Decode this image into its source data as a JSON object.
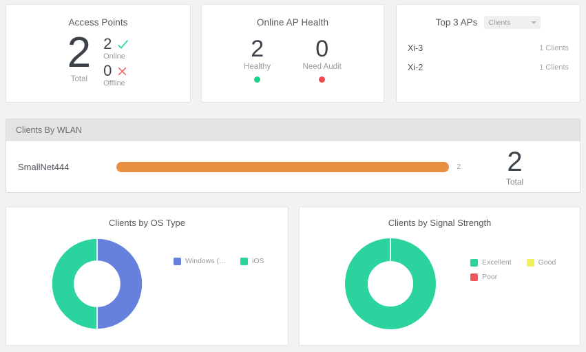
{
  "access_points": {
    "title": "Access Points",
    "total_value": "2",
    "total_label": "Total",
    "online_value": "2",
    "online_label": "Online",
    "online_icon": "check-icon",
    "online_color": "#2ed3a3",
    "offline_value": "0",
    "offline_label": "Offline",
    "offline_icon": "cross-icon",
    "offline_color": "#ef5b5b"
  },
  "ap_health": {
    "title": "Online AP Health",
    "items": [
      {
        "value": "2",
        "label": "Healthy",
        "dot_color": "#1fd18f"
      },
      {
        "value": "0",
        "label": "Need Audit",
        "dot_color": "#f0484f"
      }
    ]
  },
  "top_aps": {
    "title": "Top 3 APs",
    "selector_value": "Clients",
    "rows": [
      {
        "name": "Xi-3",
        "count": "1 Clients"
      },
      {
        "name": "Xi-2",
        "count": "1 Clients"
      }
    ]
  },
  "clients_by_wlan": {
    "header": "Clients By WLAN",
    "row_label": "SmallNet444",
    "bar_value_label": "2",
    "bar_color": "#e8903f",
    "total_value": "2",
    "total_label": "Total"
  },
  "chart_data": [
    {
      "type": "pie",
      "title": "Clients by OS Type",
      "subtype": "donut",
      "legend_position": "right",
      "labels": [
        "Windows (M...",
        "iOS"
      ],
      "values": [
        1,
        1
      ],
      "percentages": [
        50,
        50
      ],
      "colors": [
        "#6680de",
        "#2bd39e"
      ],
      "xlabel": "",
      "ylabel": ""
    },
    {
      "type": "pie",
      "title": "Clients by Signal Strength",
      "subtype": "donut",
      "legend_position": "right",
      "labels": [
        "Excellent",
        "Good",
        "Poor"
      ],
      "values": [
        2,
        0,
        0
      ],
      "percentages": [
        100,
        0,
        0
      ],
      "colors": [
        "#2bd39e",
        "#eff05a",
        "#f0555a"
      ],
      "xlabel": "",
      "ylabel": ""
    }
  ]
}
